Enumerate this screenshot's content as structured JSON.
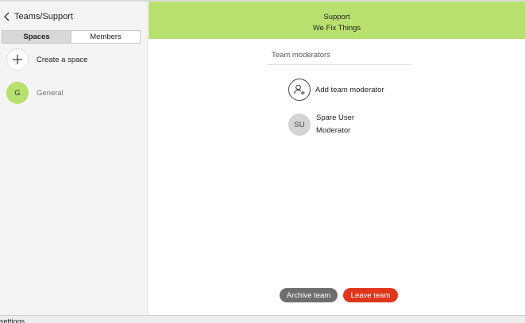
{
  "breadcrumb": {
    "label": "Teams/Support",
    "icon": "chevron-left-icon"
  },
  "tabs": [
    {
      "label": "Spaces",
      "active": true
    },
    {
      "label": "Members",
      "active": false
    }
  ],
  "spaces": {
    "create_label": "Create a space",
    "create_icon": "plus-icon",
    "items": [
      {
        "avatar": "G",
        "label": "General"
      }
    ]
  },
  "team": {
    "name": "Support",
    "description": "We Fix Things",
    "header_color": "#b8e06e"
  },
  "moderators": {
    "section_title": "Team moderators",
    "add_label": "Add team moderator",
    "add_icon": "add-person-icon",
    "list": [
      {
        "initials": "SU",
        "name": "Spare User",
        "role": "Moderator"
      }
    ]
  },
  "actions": {
    "archive_label": "Archive team",
    "leave_label": "Leave team",
    "leave_color": "#e0361c"
  },
  "status_bar": {
    "text": "settings"
  }
}
